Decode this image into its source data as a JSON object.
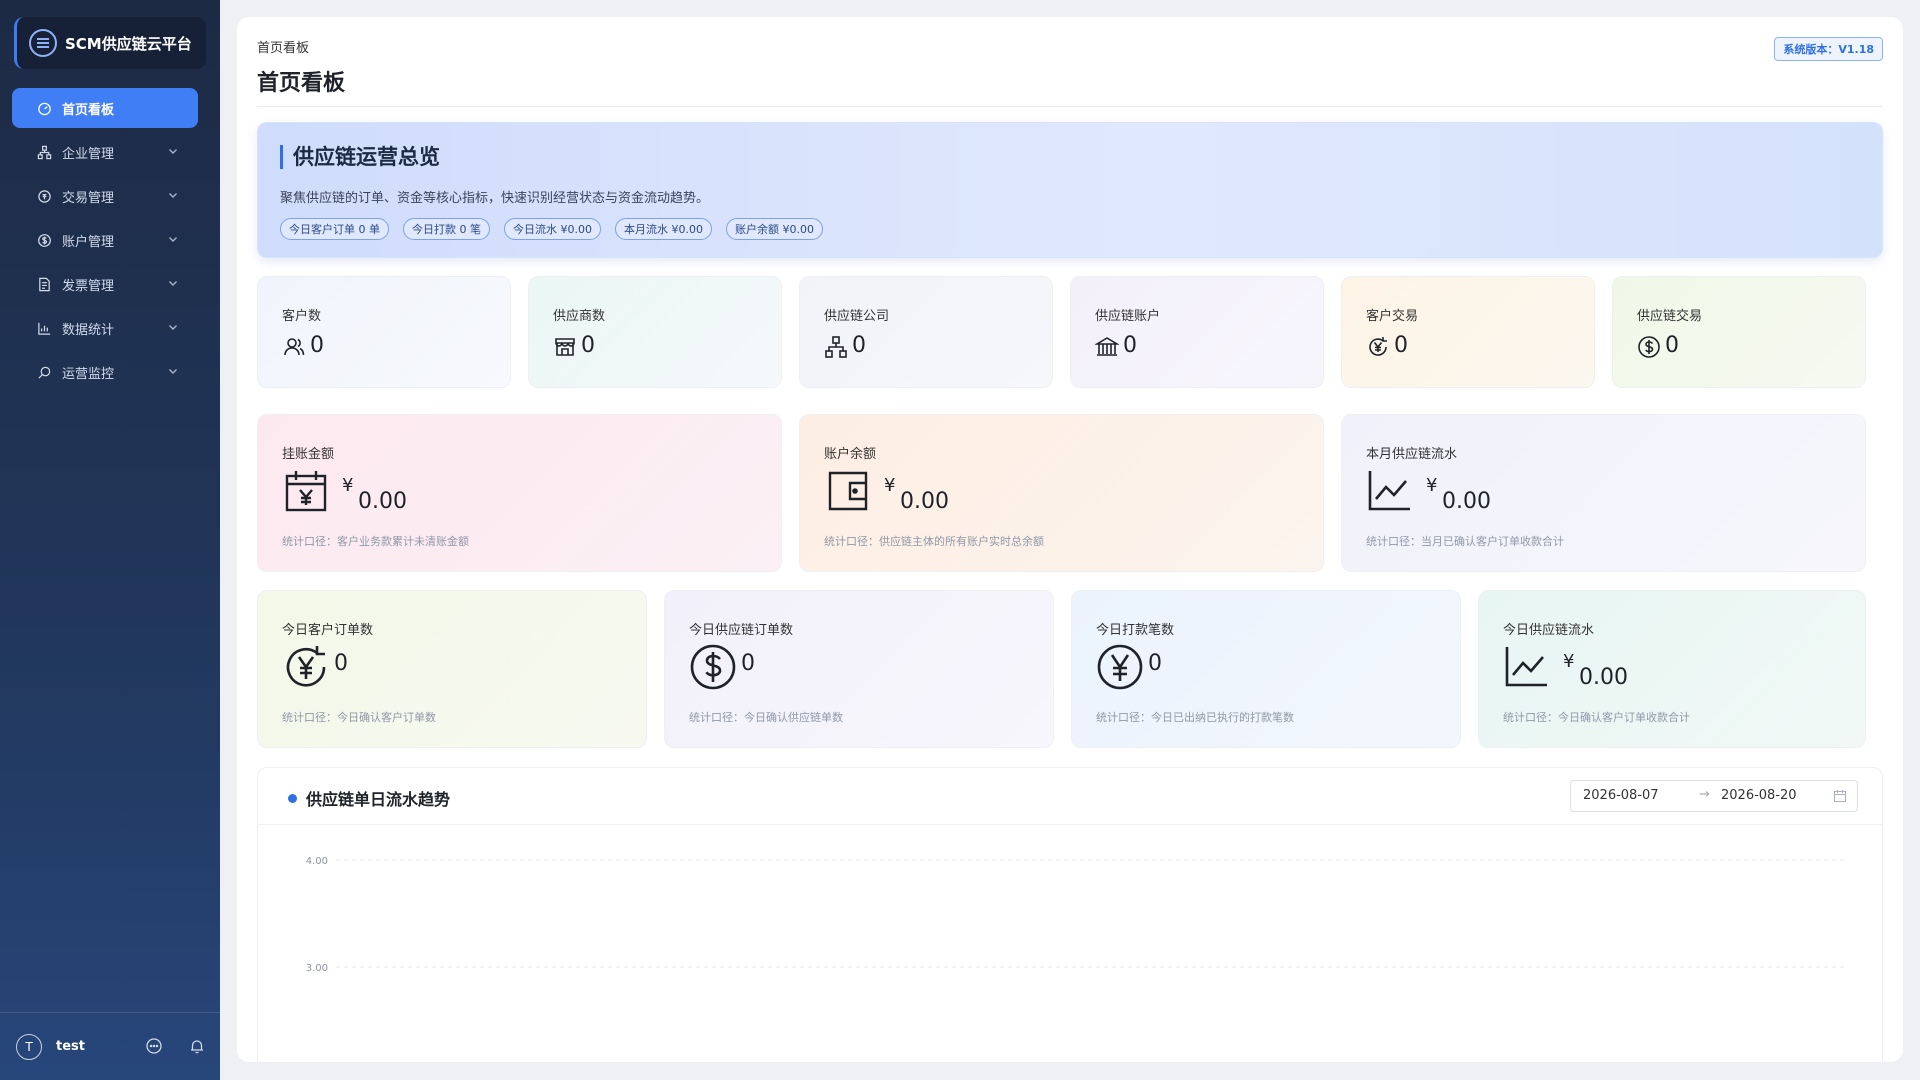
{
  "app": {
    "brand_name": "SCM供应链云平台",
    "version_badge": "系统版本：V1.18"
  },
  "sidebar": {
    "items": [
      {
        "label": "首页看板",
        "icon": "dashboard-icon",
        "active": true
      },
      {
        "label": "企业管理",
        "icon": "org-icon"
      },
      {
        "label": "交易管理",
        "icon": "exchange-icon"
      },
      {
        "label": "账户管理",
        "icon": "dollar-circle-icon"
      },
      {
        "label": "发票管理",
        "icon": "invoice-icon"
      },
      {
        "label": "数据统计",
        "icon": "bar-chart-icon"
      },
      {
        "label": "运营监控",
        "icon": "monitor-search-icon"
      }
    ],
    "user": {
      "avatar_initial": "T",
      "name": "test"
    }
  },
  "header": {
    "breadcrumb": "首页看板",
    "title": "首页看板"
  },
  "overview": {
    "title": "供应链运营总览",
    "description": "聚焦供应链的订单、资金等核心指标，快速识别经营状态与资金流动趋势。",
    "tags": [
      "今日客户订单 0 单",
      "今日打款 0 笔",
      "今日流水 ¥0.00",
      "本月流水 ¥0.00",
      "账户余额 ¥0.00"
    ]
  },
  "stat_cards": [
    {
      "label": "客户数",
      "value": "0",
      "icon": "users-icon"
    },
    {
      "label": "供应商数",
      "value": "0",
      "icon": "store-icon"
    },
    {
      "label": "供应链公司",
      "value": "0",
      "icon": "org-tree-icon"
    },
    {
      "label": "供应链账户",
      "value": "0",
      "icon": "bank-icon"
    },
    {
      "label": "客户交易",
      "value": "0",
      "icon": "yen-cycle-icon"
    },
    {
      "label": "供应链交易",
      "value": "0",
      "icon": "dollar-circle-icon"
    }
  ],
  "money_cards": [
    {
      "label": "挂账金额",
      "currency": "¥",
      "value": "0.00",
      "note": "统计口径：客户业务款累计未清账金额",
      "icon": "calendar-yen-icon"
    },
    {
      "label": "账户余额",
      "currency": "¥",
      "value": "0.00",
      "note": "统计口径：供应链主体的所有账户实时总余额",
      "icon": "wallet-icon"
    },
    {
      "label": "本月供应链流水",
      "currency": "¥",
      "value": "0.00",
      "note": "统计口径：当月已确认客户订单收款合计",
      "icon": "line-chart-icon"
    }
  ],
  "today_cards": [
    {
      "label": "今日客户订单数",
      "value": "0",
      "note": "统计口径：今日确认客户订单数",
      "icon": "yen-cycle-icon"
    },
    {
      "label": "今日供应链订单数",
      "value": "0",
      "note": "统计口径：今日确认供应链单数",
      "icon": "dollar-circle-icon"
    },
    {
      "label": "今日打款笔数",
      "value": "0",
      "note": "统计口径：今日已出纳已执行的打款笔数",
      "icon": "yen-circle-icon"
    },
    {
      "label": "今日供应链流水",
      "currency": "¥",
      "value": "0.00",
      "note": "统计口径：今日确认客户订单收款合计",
      "icon": "line-chart-icon"
    }
  ],
  "trend": {
    "title": "供应链单日流水趋势",
    "date_start": "2026-08-07",
    "date_separator": "→",
    "date_end": "2026-08-20"
  },
  "chart_data": {
    "type": "line",
    "title": "供应链单日流水趋势",
    "y_tick_labels": [
      "4.00",
      "3.00"
    ],
    "ylim": [
      3.0,
      4.0
    ],
    "grid": true,
    "series": []
  },
  "colors": {
    "accent": "#3f7ef5",
    "sidebar_bg": "#1d2a44"
  }
}
